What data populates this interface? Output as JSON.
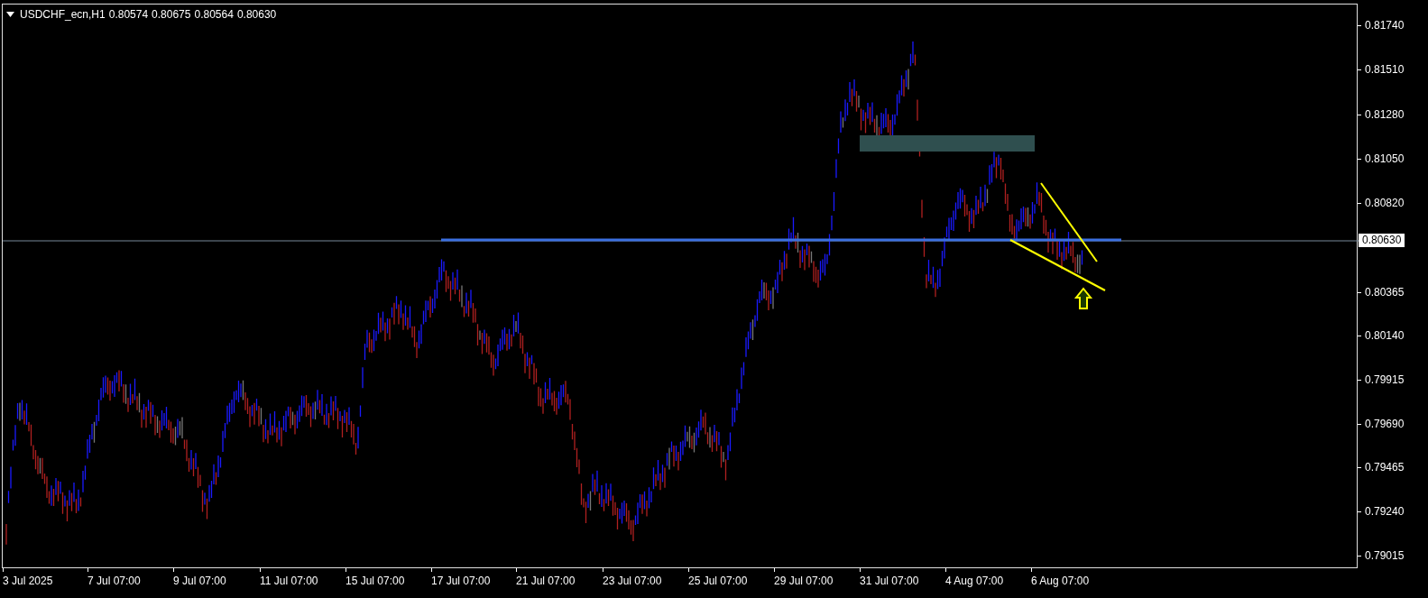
{
  "chart_header": {
    "symbol": "USDCHF_ecn,H1",
    "quotes": [
      "0.80574",
      "0.80675",
      "0.80564",
      "0.80630"
    ]
  },
  "price_axis": {
    "ticks": [
      "0.81740",
      "0.81510",
      "0.81280",
      "0.81050",
      "0.80820",
      "0.80365",
      "0.80140",
      "0.79915",
      "0.79690",
      "0.79465",
      "0.79240",
      "0.79015"
    ],
    "current_price": "0.80630"
  },
  "time_axis": {
    "ticks": [
      "3 Jul 2025",
      "7 Jul 07:00",
      "9 Jul 07:00",
      "11 Jul 07:00",
      "15 Jul 07:00",
      "17 Jul 07:00",
      "21 Jul 07:00",
      "23 Jul 07:00",
      "25 Jul 07:00",
      "29 Jul 07:00",
      "31 Jul 07:00",
      "4 Aug 07:00",
      "6 Aug 07:00"
    ]
  }
}
